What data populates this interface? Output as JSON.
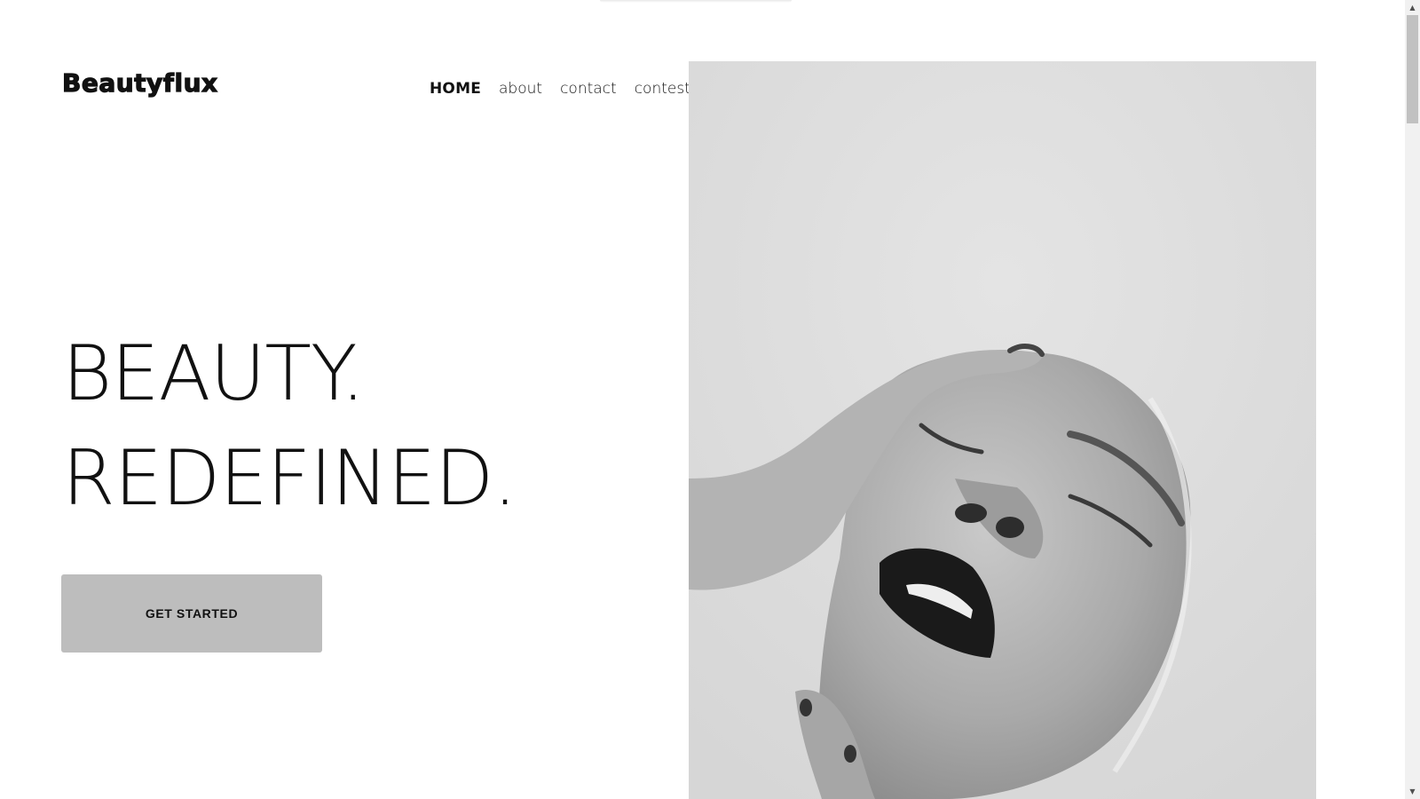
{
  "header": {
    "logo_text": "Beautyflux",
    "nav": {
      "home": "HOME",
      "about": "about",
      "contact": "contact",
      "contest": "contest"
    }
  },
  "hero": {
    "line1": "BEAUTY.",
    "line2": "REDEFINED.",
    "cta_label": "GET STARTED"
  },
  "colors": {
    "text": "#111111",
    "cta_background": "#bdbdbd",
    "photo_background": "#dedede"
  },
  "scrollbar": {
    "up_icon": "chevron-up-icon",
    "down_icon": "chevron-down-icon"
  }
}
